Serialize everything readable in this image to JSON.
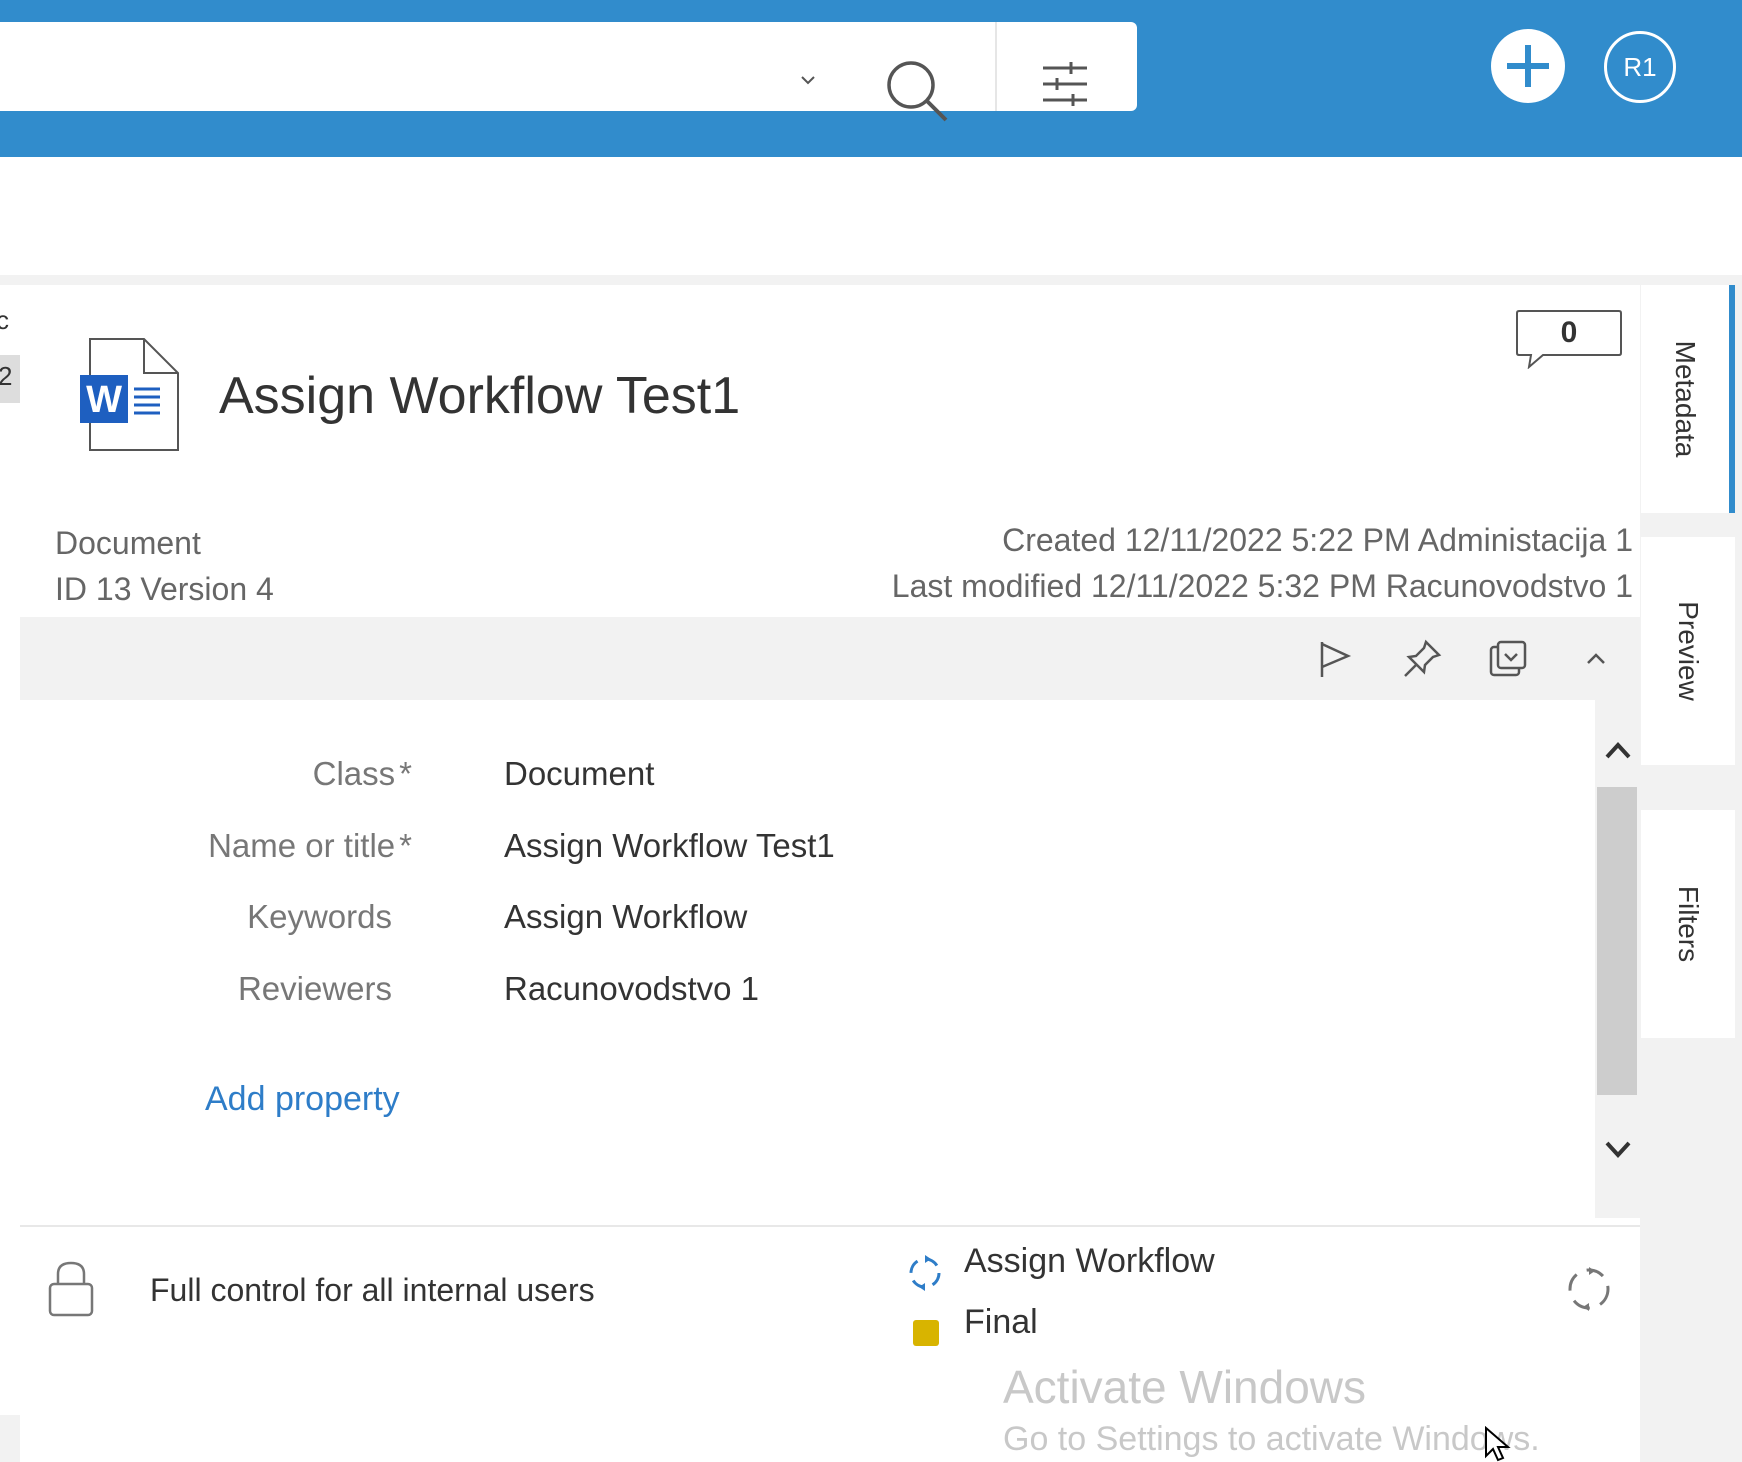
{
  "header": {
    "search_placeholder": "",
    "icons": [
      "chevron-down-icon",
      "search-icon",
      "filter-icon",
      "add-icon"
    ],
    "avatar_initials": "R1",
    "brand_color": "#318ccc"
  },
  "left_edge": {
    "fragment1": "c",
    "fragment2": "2"
  },
  "document": {
    "icon": "word-document-icon",
    "title": "Assign Workflow Test1",
    "comment_count": "0",
    "type": "Document",
    "id_version": "ID 13  Version 4",
    "created": "Created 12/11/2022 5:22 PM Administacija 1",
    "last_modified": "Last modified 12/11/2022 5:32 PM Racunovodstvo 1"
  },
  "actions": [
    "flag-icon",
    "pin-icon",
    "popout-icon",
    "collapse-icon"
  ],
  "properties": [
    {
      "label": "Class",
      "required_mark": "*",
      "value": "Document"
    },
    {
      "label": "Name or title",
      "required_mark": "*",
      "value": "Assign Workflow Test1"
    },
    {
      "label": "Keywords",
      "required_mark": "",
      "value": "Assign Workflow"
    },
    {
      "label": "Reviewers",
      "required_mark": "",
      "value": "Racunovodstvo 1"
    }
  ],
  "add_property": "Add property",
  "footer": {
    "permissions": "Full control for all internal users",
    "workflow": "Assign Workflow",
    "state": "Final",
    "state_color": "#d8b400"
  },
  "side_tabs": [
    "Metadata",
    "Preview",
    "Filters"
  ],
  "watermark": {
    "line1": "Activate Windows",
    "line2": "Go to Settings to activate Windows."
  }
}
